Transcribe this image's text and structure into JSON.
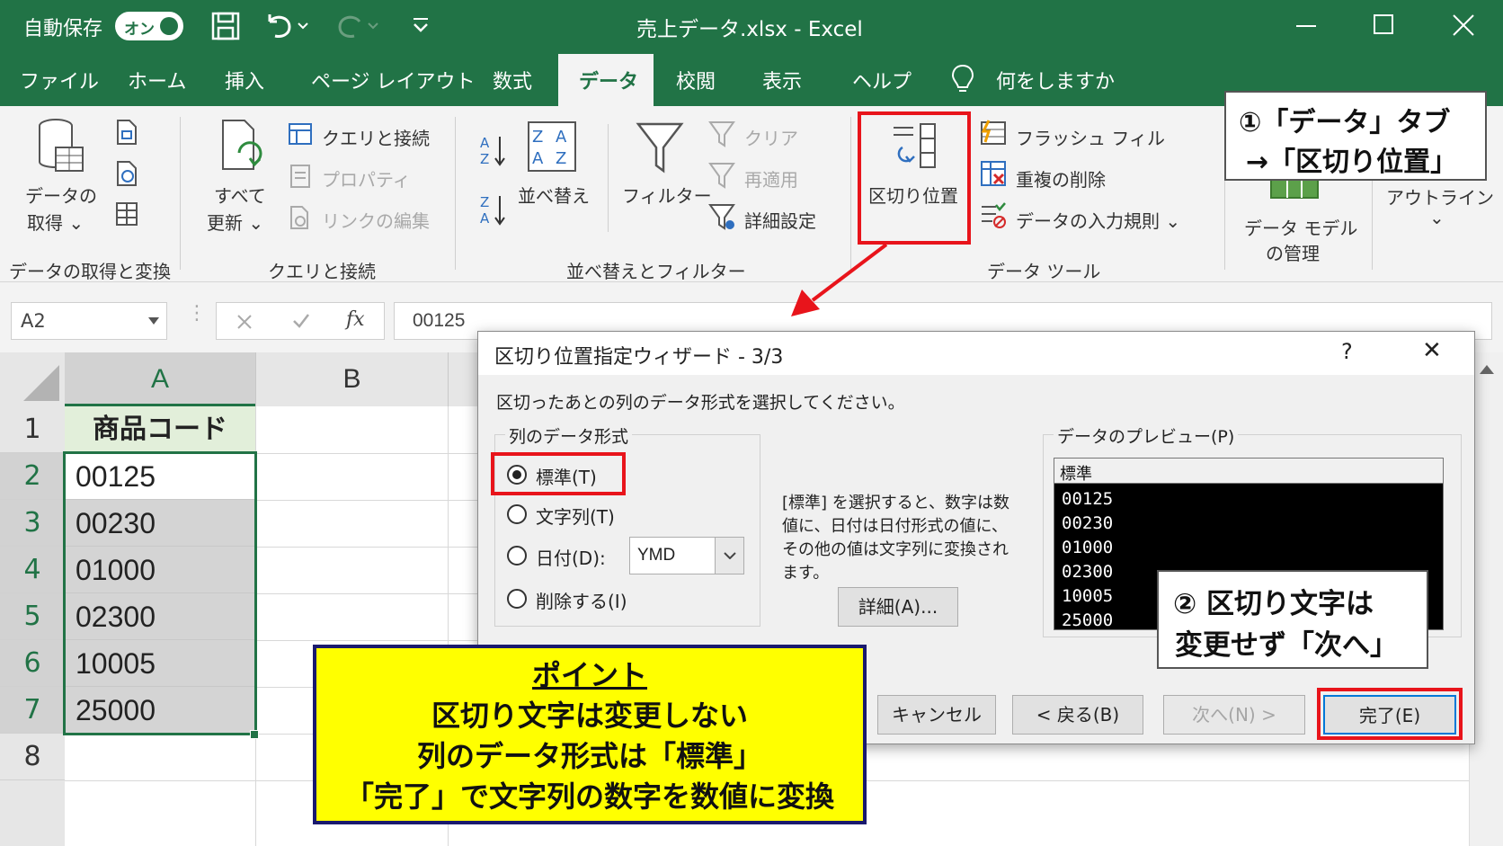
{
  "titlebar": {
    "autosave_label": "自動保存",
    "autosave_state": "オン",
    "file_title": "売上データ.xlsx  -  Excel"
  },
  "tabs": [
    "ファイル",
    "ホーム",
    "挿入",
    "ページ レイアウト",
    "数式",
    "データ",
    "校閲",
    "表示",
    "ヘルプ"
  ],
  "tell_me": "何をしますか",
  "ribbon": {
    "get_data": "データの\n取得",
    "get_data_l1": "データの",
    "get_data_l2": "取得 ⌄",
    "group_get": "データの取得と変換",
    "refresh_l1": "すべて",
    "refresh_l2": "更新 ⌄",
    "queries": "クエリと接続",
    "properties": "プロパティ",
    "edit_links": "リンクの編集",
    "group_queries": "クエリと接続",
    "sort": "並べ替え",
    "filter": "フィルター",
    "clear": "クリア",
    "reapply": "再適用",
    "advanced": "詳細設定",
    "group_sort": "並べ替えとフィルター",
    "text_to_columns": "区切り位置",
    "flash_fill": "フラッシュ フィル",
    "remove_dupes": "重複の削除",
    "validation": "データの入力規則  ⌄",
    "group_tools": "データ ツール",
    "data_model_l1": "データ モデル",
    "data_model_l2": "の管理",
    "outline": "アウトライン",
    "outline_caret": "⌄"
  },
  "formula_bar": {
    "name_box": "A2",
    "fx": "fx",
    "value": "00125"
  },
  "sheet": {
    "col_a": "A",
    "col_b": "B",
    "rows": [
      "1",
      "2",
      "3",
      "4",
      "5",
      "6",
      "7",
      "8"
    ],
    "cells": [
      "商品コード",
      "00125",
      "00230",
      "01000",
      "02300",
      "10005",
      "25000"
    ]
  },
  "dialog": {
    "title": "区切り位置指定ウィザード - 3/3",
    "help": "?",
    "close": "✕",
    "instruction": "区切ったあとの列のデータ形式を選択してください。",
    "format_group": "列のデータ形式",
    "opt_general": "標準(T)",
    "opt_text": "文字列(T)",
    "opt_date": "日付(D):",
    "date_value": "YMD",
    "opt_skip": "削除する(I)",
    "desc_l1": "[標準] を選択すると、数字は数",
    "desc_l2": "値に、日付は日付形式の値に、",
    "desc_l3": "その他の値は文字列に変換され",
    "desc_l4": "ます。",
    "advanced_btn": "詳細(A)...",
    "preview_label": "データのプレビュー(P)",
    "preview_header": "標準",
    "preview_rows": [
      "00125",
      "00230",
      "01000",
      "02300",
      "10005",
      "25000"
    ],
    "cancel": "キャンセル",
    "back": "< 戻る(B)",
    "next": "次へ(N) >",
    "finish": "完了(E)"
  },
  "annotations": {
    "callout1_l1": "①「データ」タブ",
    "callout1_l2": "→「区切り位置」",
    "callout2_l1": "② 区切り文字は",
    "callout2_l2": "変更せず「次へ」",
    "point_title": "ポイント",
    "point_l1": "区切り文字は変更しない",
    "point_l2": "列のデータ形式は「標準」",
    "point_l3": "「完了」で文字列の数字を数値に変換"
  },
  "colors": {
    "excel_green": "#217346",
    "highlight_red": "#e8141b",
    "point_yellow": "#ffff00"
  }
}
